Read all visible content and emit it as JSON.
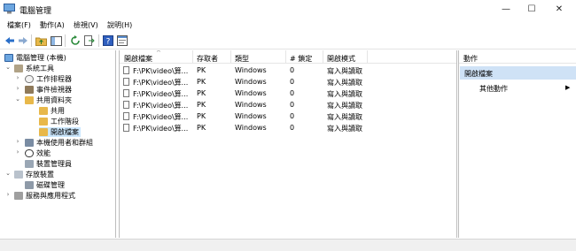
{
  "window": {
    "title": "電腦管理",
    "controls": {
      "minimize": "—",
      "maximize": "☐",
      "close": "✕"
    }
  },
  "menu": [
    "檔案(F)",
    "動作(A)",
    "檢視(V)",
    "說明(H)"
  ],
  "toolbar": {
    "icons": [
      "back-arrow-icon",
      "forward-arrow-icon",
      "up-folder-icon",
      "show-hide-tree-icon",
      "refresh-icon",
      "export-list-icon",
      "help-icon",
      "properties-icon"
    ]
  },
  "tree": {
    "root": "電腦管理 (本機)",
    "system_tools": "系統工具",
    "task_scheduler": "工作排程器",
    "event_viewer": "事件檢視器",
    "shared_folders": "共用資料夾",
    "shares": "共用",
    "sessions": "工作階段",
    "open_files": "開啟檔案",
    "local_users": "本機使用者和群組",
    "performance": "效能",
    "device_manager": "裝置管理員",
    "storage": "存放裝置",
    "disk_management": "磁碟管理",
    "services": "服務與應用程式"
  },
  "list": {
    "columns": [
      "開啟檔案",
      "存取者",
      "類型",
      "# 鎖定",
      "開啟模式"
    ],
    "rows": [
      {
        "file": "F:\\PK\\video\\算...",
        "user": "PK",
        "type": "Windows",
        "locks": "0",
        "mode": "寫入與讀取"
      },
      {
        "file": "F:\\PK\\video\\算...",
        "user": "PK",
        "type": "Windows",
        "locks": "0",
        "mode": "寫入與讀取"
      },
      {
        "file": "F:\\PK\\video\\算...",
        "user": "PK",
        "type": "Windows",
        "locks": "0",
        "mode": "寫入與讀取"
      },
      {
        "file": "F:\\PK\\video\\算...",
        "user": "PK",
        "type": "Windows",
        "locks": "0",
        "mode": "寫入與讀取"
      },
      {
        "file": "F:\\PK\\video\\算...",
        "user": "PK",
        "type": "Windows",
        "locks": "0",
        "mode": "寫入與讀取"
      },
      {
        "file": "F:\\PK\\video\\算...",
        "user": "PK",
        "type": "Windows",
        "locks": "0",
        "mode": "寫入與讀取"
      }
    ]
  },
  "actions": {
    "title": "動作",
    "section": "開啟檔案",
    "more": "其他動作",
    "more_arrow": "▶"
  },
  "colors": {
    "selection": "#cce8ff",
    "action_section": "#cfe2f6",
    "folder": "#e8b84a",
    "arrow": "#2a6fc9"
  }
}
